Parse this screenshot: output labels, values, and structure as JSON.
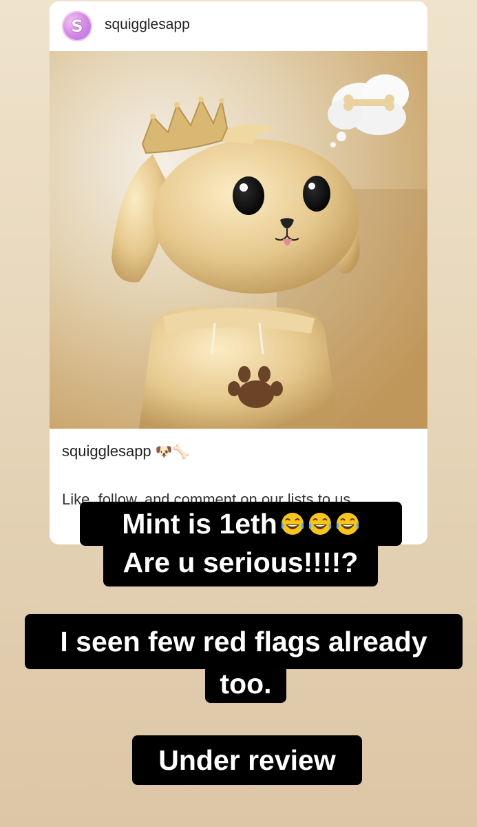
{
  "post": {
    "username": "squigglesapp",
    "avatar_letter": "S",
    "caption_user": "squigglesapp",
    "caption_emoji": "🐶🦴",
    "caption_text": "Like, follow, and comment on our lists to us",
    "image_icons": [
      "crown-icon",
      "thought-bubble-icon",
      "bone-icon",
      "paw-icon"
    ]
  },
  "stickers": {
    "line1": "Mint is 1eth",
    "line1_emoji_name": "laughing-tears-emoji",
    "line2": "Are u serious!!!!?",
    "line3": "I seen few red flags already",
    "line4": "too.",
    "line5": "Under review"
  },
  "colors": {
    "background": "#e7d6ba",
    "sticker_bg": "#000000",
    "sticker_text": "#ffffff",
    "gold": "#e4c98f"
  }
}
